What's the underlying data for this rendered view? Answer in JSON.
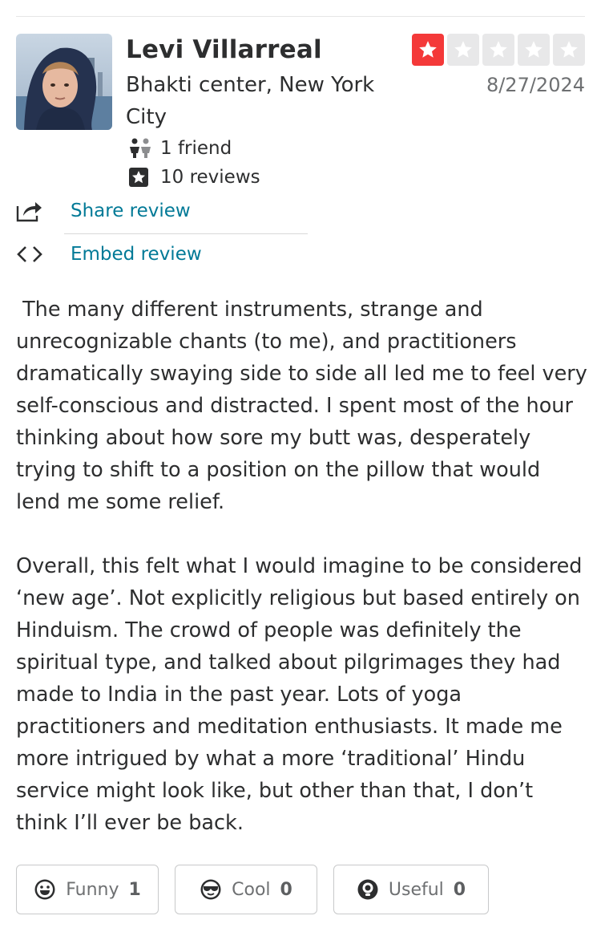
{
  "reviewer": {
    "name": "Levi Villarreal",
    "location": "Bhakti center, New York City",
    "friends": "1 friend",
    "reviews": "10 reviews"
  },
  "rating": {
    "value": 1,
    "max": 5,
    "active_color": "#f43939",
    "inactive_color": "#e8e8e9"
  },
  "date": "8/27/2024",
  "actions": {
    "share_label": "Share review",
    "embed_label": "Embed review"
  },
  "review": {
    "paragraph_1": " The many different instruments, strange and unrecognizable chants (to me), and practitioners dramatically swaying side to side all led me to feel very self-conscious and distracted. I spent most of the hour thinking about how sore my butt was, desperately trying to shift to a position on the pillow that would lend me some relief.",
    "paragraph_2": "Overall, this felt what I would imagine to be considered ‘new age’. Not explicitly religious but based entirely on Hinduism. The crowd of people was definitely the spiritual type, and talked about pilgrimages they had made to India in the past year. Lots of yoga practitioners and meditation enthusiasts. It made me more intrigued by what a more ‘traditional’ Hindu service might look like, but other than that, I don’t think I’ll ever be back."
  },
  "votes": {
    "funny": {
      "label": "Funny",
      "count": "1",
      "icon": "funny-face-icon"
    },
    "cool": {
      "label": "Cool",
      "count": "0",
      "icon": "sunglasses-face-icon"
    },
    "useful": {
      "label": "Useful",
      "count": "0",
      "icon": "lightbulb-icon"
    }
  },
  "colors": {
    "link": "#027a97",
    "text": "#2d2e2f",
    "muted": "#6e7072"
  }
}
